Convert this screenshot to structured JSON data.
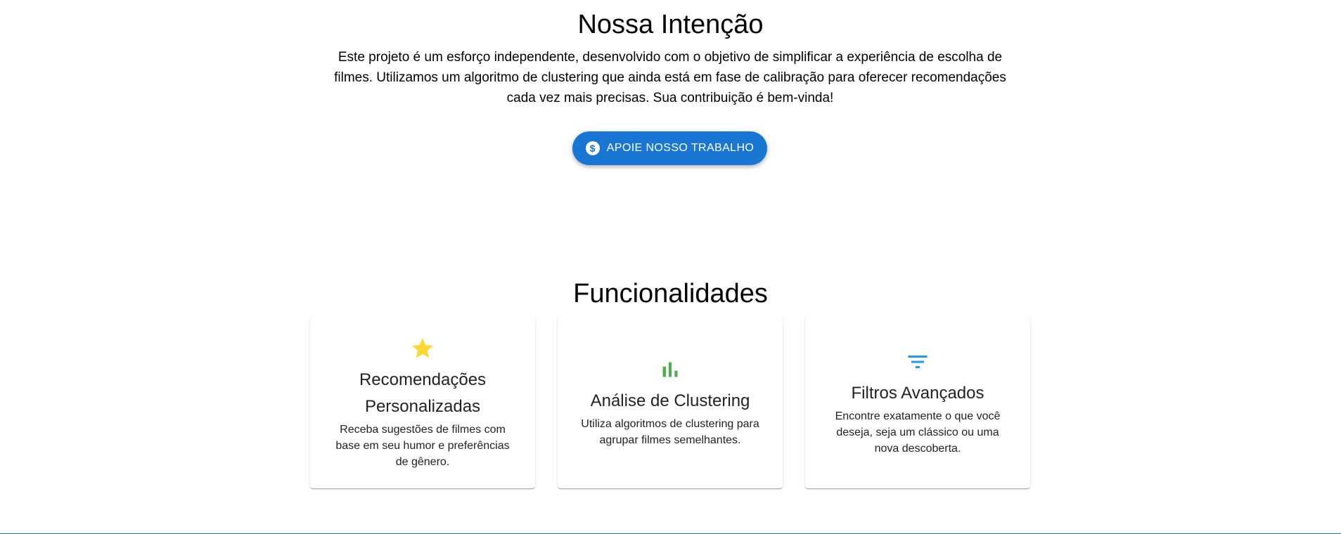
{
  "intent": {
    "title": "Nossa Intenção",
    "text": "Este projeto é um esforço independente, desenvolvido com o objetivo de simplificar a experiência de escolha de filmes. Utilizamos um algoritmo de clustering que ainda está em fase de calibração para oferecer recomendações cada vez mais precisas. Sua contribuição é bem-vinda!",
    "button_label": "APOIE NOSSO TRABALHO",
    "button_icon": "dollar-circle-icon",
    "button_color": "#1976d2"
  },
  "features": {
    "title": "Funcionalidades",
    "cards": [
      {
        "icon": "star-icon",
        "icon_color": "#fdd835",
        "title": "Recomendações Personalizadas",
        "text": "Receba sugestões de filmes com base em seu humor e preferências de gênero."
      },
      {
        "icon": "bar-chart-icon",
        "icon_color": "#4caf50",
        "title": "Análise de Clustering",
        "text": "Utiliza algoritmos de clustering para agrupar filmes semelhantes."
      },
      {
        "icon": "filter-icon",
        "icon_color": "#2196f3",
        "title": "Filtros Avançados",
        "text": "Encontre exatamente o que você deseja, seja um clássico ou uma nova descoberta."
      }
    ]
  }
}
